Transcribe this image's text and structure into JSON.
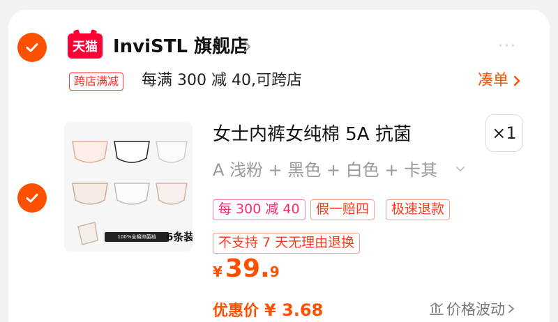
{
  "store": {
    "logo_text": "天猫",
    "name": "InviSTL 旗舰店"
  },
  "promo": {
    "tag": "跨店满减",
    "text": "每满 300 减 40,可跨店",
    "bundle_label": "凑单"
  },
  "product": {
    "title": "女士内裤女纯棉 5A 抗菌",
    "quantity": "×1",
    "variant": "A 浅粉 + 黑色 + 白色 + 卡其",
    "tags": [
      "每 300 减 40",
      "假一赔四",
      "极速退款",
      "不支持 7 天无理由退换"
    ],
    "image_banner": "100%全棉抑菌裆",
    "image_count": "6条装",
    "price_symbol": "¥",
    "price_int": "39.",
    "price_dec": "9",
    "coupon_label": "优惠价",
    "coupon_price": "¥ 3.68",
    "price_trend_label": "价格波动"
  },
  "colors": {
    "accent": "#ff5000",
    "tmall_red": "#ff0036"
  }
}
